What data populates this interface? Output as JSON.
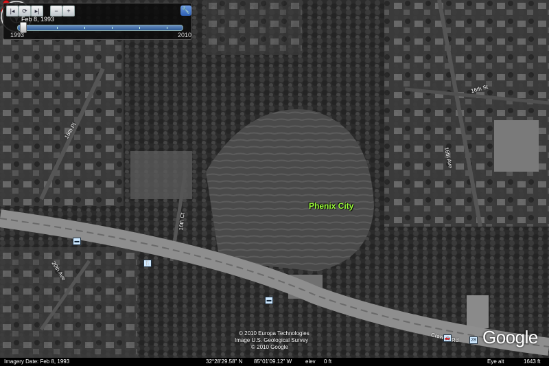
{
  "time_slider": {
    "date": "Feb  8, 1993",
    "start_year": "1993",
    "end_year": "2010"
  },
  "placemark": {
    "label": "Phenix City"
  },
  "road_labels": [
    {
      "text": "16th Pl"
    },
    {
      "text": "16th St"
    },
    {
      "text": "16th Ave"
    },
    {
      "text": "16th Ct"
    },
    {
      "text": "20th Ave"
    },
    {
      "text": "Craw"
    },
    {
      "text": "Rd"
    }
  ],
  "compass": {
    "north": "N"
  },
  "copyright": {
    "line1": "© 2010 Europa Technologies",
    "line2": "Image U.S. Geological Survey",
    "line3": "© 2010 Google"
  },
  "logo": "Google",
  "status_bar": {
    "imagery_date": "Imagery Date: Feb  8, 1993",
    "lat": "32°28'29.58\" N",
    "lon": "85°01'09.12\" W",
    "elev_label": "elev",
    "elev_value": "0 ft",
    "eye_label": "Eye alt",
    "eye_value": "1643 ft"
  },
  "colors": {
    "placemark_label": "#9cff3a",
    "pin": "#e0151b",
    "slider": "#2f5b97"
  }
}
